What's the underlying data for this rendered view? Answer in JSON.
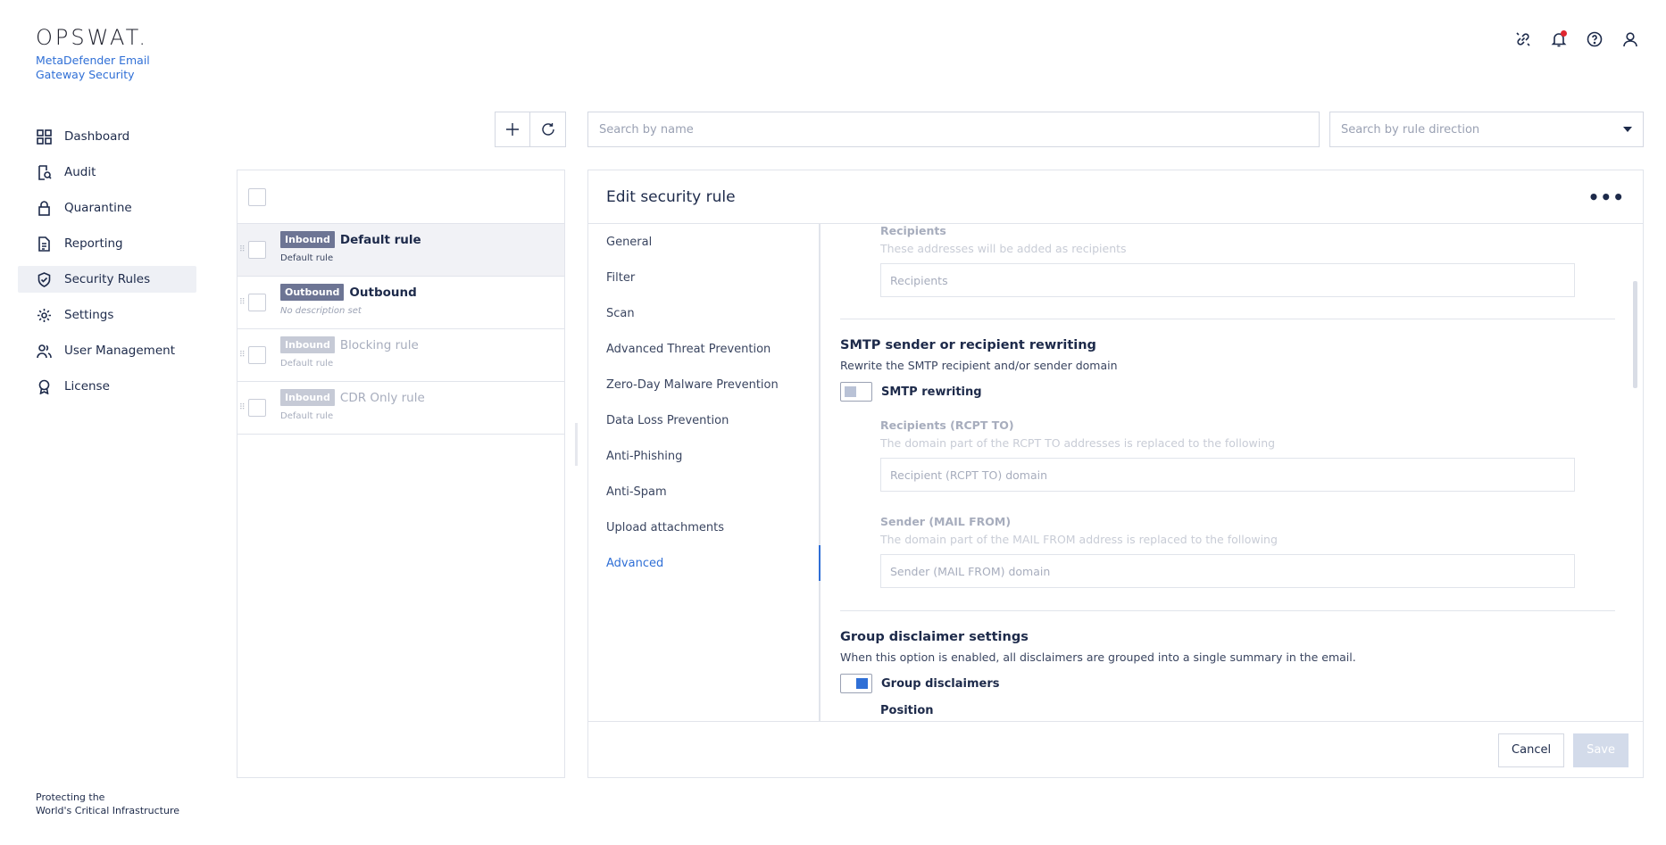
{
  "brand": {
    "logo": "OPSWAT.",
    "product": "MetaDefender Email Gateway Security",
    "footer_line1": "Protecting the",
    "footer_line2": "World's Critical Infrastructure"
  },
  "nav": {
    "items": [
      {
        "label": "Dashboard",
        "icon": "dashboard-icon"
      },
      {
        "label": "Audit",
        "icon": "audit-icon"
      },
      {
        "label": "Quarantine",
        "icon": "lock-icon"
      },
      {
        "label": "Reporting",
        "icon": "document-icon"
      },
      {
        "label": "Security Rules",
        "icon": "shield-check-icon",
        "active": true
      },
      {
        "label": "Settings",
        "icon": "gear-icon"
      },
      {
        "label": "User Management",
        "icon": "users-icon"
      },
      {
        "label": "License",
        "icon": "award-icon"
      }
    ]
  },
  "toolbar": {
    "search_placeholder": "Search by name",
    "direction_placeholder": "Search by rule direction"
  },
  "rules": [
    {
      "direction": "Inbound",
      "name": "Default rule",
      "description": "Default rule",
      "selected": true,
      "enabled": true
    },
    {
      "direction": "Outbound",
      "name": "Outbound",
      "description": "No description set",
      "enabled": true
    },
    {
      "direction": "Inbound",
      "name": "Blocking rule",
      "description": "Default rule",
      "enabled": false
    },
    {
      "direction": "Inbound",
      "name": "CDR Only rule",
      "description": "Default rule",
      "enabled": false
    }
  ],
  "edit": {
    "title": "Edit security rule",
    "tabs": [
      "General",
      "Filter",
      "Scan",
      "Advanced Threat Prevention",
      "Zero-Day Malware Prevention",
      "Data Loss Prevention",
      "Anti-Phishing",
      "Anti-Spam",
      "Upload attachments",
      "Advanced"
    ],
    "active_tab": "Advanced",
    "recipients": {
      "label": "Recipients",
      "hint": "These addresses will be added as recipients",
      "placeholder": "Recipients"
    },
    "smtp": {
      "title": "SMTP sender or recipient rewriting",
      "description": "Rewrite the SMTP recipient and/or sender domain",
      "toggle_label": "SMTP rewriting",
      "toggle_on": false,
      "rcpt_label": "Recipients (RCPT TO)",
      "rcpt_hint": "The domain part of the RCPT TO addresses is replaced to the following",
      "rcpt_placeholder": "Recipient (RCPT TO) domain",
      "sender_label": "Sender (MAIL FROM)",
      "sender_hint": "The domain part of the MAIL FROM address is replaced to the following",
      "sender_placeholder": "Sender (MAIL FROM) domain"
    },
    "disclaimer": {
      "title": "Group disclaimer settings",
      "description": "When this option is enabled, all disclaimers are grouped into a single summary in the email.",
      "toggle_label": "Group disclaimers",
      "toggle_on": true,
      "position_label": "Position"
    },
    "cancel_label": "Cancel",
    "save_label": "Save"
  }
}
